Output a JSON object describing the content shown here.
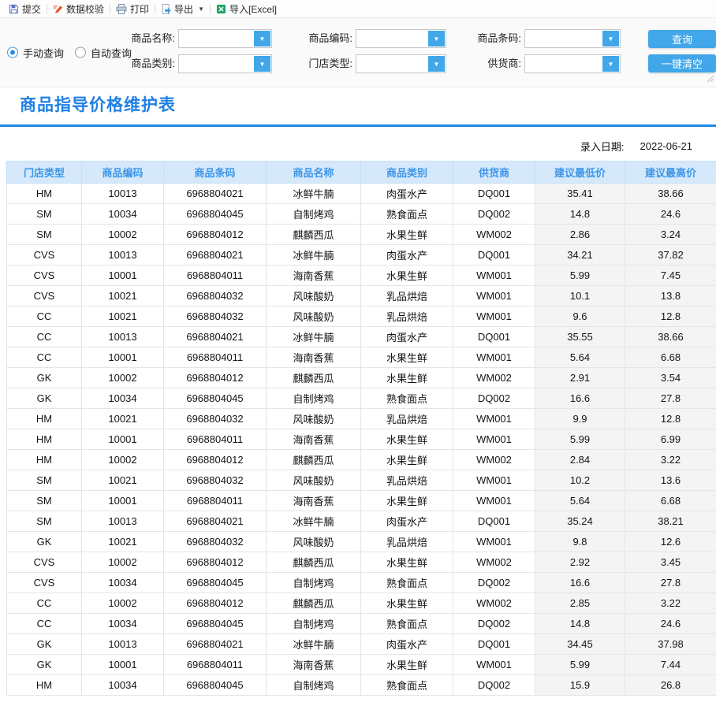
{
  "toolbar": {
    "submit_label": "提交",
    "validate_label": "数据校验",
    "print_label": "打印",
    "export_label": "导出",
    "import_label": "导入[Excel]"
  },
  "icons": {
    "caret_down": "▼",
    "export_caret": "▼"
  },
  "filters": {
    "manual_query_label": "手动查询",
    "auto_query_label": "自动查询",
    "fields": [
      {
        "label": "商品名称:",
        "value": ""
      },
      {
        "label": "商品编码:",
        "value": ""
      },
      {
        "label": "商品条码:",
        "value": ""
      },
      {
        "label": "商品类别:",
        "value": ""
      },
      {
        "label": "门店类型:",
        "value": ""
      },
      {
        "label": "供货商:",
        "value": ""
      }
    ],
    "query_button_label": "查询",
    "clear_button_label": "一键清空"
  },
  "page": {
    "title": "商品指导价格维护表",
    "entry_date_label": "录入日期:",
    "entry_date_value": "2022-06-21"
  },
  "table": {
    "columns": [
      "门店类型",
      "商品编码",
      "商品条码",
      "商品名称",
      "商品类别",
      "供货商",
      "建议最低价",
      "建议最高价"
    ],
    "rows": [
      [
        "HM",
        "10013",
        "6968804021",
        "冰鲜牛腩",
        "肉蛋水产",
        "DQ001",
        "35.41",
        "38.66"
      ],
      [
        "SM",
        "10034",
        "6968804045",
        "自制烤鸡",
        "熟食面点",
        "DQ002",
        "14.8",
        "24.6"
      ],
      [
        "SM",
        "10002",
        "6968804012",
        "麒麟西瓜",
        "水果生鲜",
        "WM002",
        "2.86",
        "3.24"
      ],
      [
        "CVS",
        "10013",
        "6968804021",
        "冰鲜牛腩",
        "肉蛋水产",
        "DQ001",
        "34.21",
        "37.82"
      ],
      [
        "CVS",
        "10001",
        "6968804011",
        "海南香蕉",
        "水果生鲜",
        "WM001",
        "5.99",
        "7.45"
      ],
      [
        "CVS",
        "10021",
        "6968804032",
        "风味酸奶",
        "乳品烘焙",
        "WM001",
        "10.1",
        "13.8"
      ],
      [
        "CC",
        "10021",
        "6968804032",
        "风味酸奶",
        "乳品烘焙",
        "WM001",
        "9.6",
        "12.8"
      ],
      [
        "CC",
        "10013",
        "6968804021",
        "冰鲜牛腩",
        "肉蛋水产",
        "DQ001",
        "35.55",
        "38.66"
      ],
      [
        "CC",
        "10001",
        "6968804011",
        "海南香蕉",
        "水果生鲜",
        "WM001",
        "5.64",
        "6.68"
      ],
      [
        "GK",
        "10002",
        "6968804012",
        "麒麟西瓜",
        "水果生鲜",
        "WM002",
        "2.91",
        "3.54"
      ],
      [
        "GK",
        "10034",
        "6968804045",
        "自制烤鸡",
        "熟食面点",
        "DQ002",
        "16.6",
        "27.8"
      ],
      [
        "HM",
        "10021",
        "6968804032",
        "风味酸奶",
        "乳品烘焙",
        "WM001",
        "9.9",
        "12.8"
      ],
      [
        "HM",
        "10001",
        "6968804011",
        "海南香蕉",
        "水果生鲜",
        "WM001",
        "5.99",
        "6.99"
      ],
      [
        "HM",
        "10002",
        "6968804012",
        "麒麟西瓜",
        "水果生鲜",
        "WM002",
        "2.84",
        "3.22"
      ],
      [
        "SM",
        "10021",
        "6968804032",
        "风味酸奶",
        "乳品烘焙",
        "WM001",
        "10.2",
        "13.6"
      ],
      [
        "SM",
        "10001",
        "6968804011",
        "海南香蕉",
        "水果生鲜",
        "WM001",
        "5.64",
        "6.68"
      ],
      [
        "SM",
        "10013",
        "6968804021",
        "冰鲜牛腩",
        "肉蛋水产",
        "DQ001",
        "35.24",
        "38.21"
      ],
      [
        "GK",
        "10021",
        "6968804032",
        "风味酸奶",
        "乳品烘焙",
        "WM001",
        "9.8",
        "12.6"
      ],
      [
        "CVS",
        "10002",
        "6968804012",
        "麒麟西瓜",
        "水果生鲜",
        "WM002",
        "2.92",
        "3.45"
      ],
      [
        "CVS",
        "10034",
        "6968804045",
        "自制烤鸡",
        "熟食面点",
        "DQ002",
        "16.6",
        "27.8"
      ],
      [
        "CC",
        "10002",
        "6968804012",
        "麒麟西瓜",
        "水果生鲜",
        "WM002",
        "2.85",
        "3.22"
      ],
      [
        "CC",
        "10034",
        "6968804045",
        "自制烤鸡",
        "熟食面点",
        "DQ002",
        "14.8",
        "24.6"
      ],
      [
        "GK",
        "10013",
        "6968804021",
        "冰鲜牛腩",
        "肉蛋水产",
        "DQ001",
        "34.45",
        "37.98"
      ],
      [
        "GK",
        "10001",
        "6968804011",
        "海南香蕉",
        "水果生鲜",
        "WM001",
        "5.99",
        "7.44"
      ],
      [
        "HM",
        "10034",
        "6968804045",
        "自制烤鸡",
        "熟食面点",
        "DQ002",
        "15.9",
        "26.8"
      ]
    ]
  },
  "colors": {
    "accent_blue": "#41a7e8",
    "title_blue": "#2080e4",
    "rule_blue": "#1e88e5",
    "header_bg": "#d5e9fb",
    "header_text": "#3e96e8",
    "shaded_cell": "#f4f4f4",
    "validate_icon_orange": "#e2572b",
    "excel_icon_green": "#21a366"
  }
}
